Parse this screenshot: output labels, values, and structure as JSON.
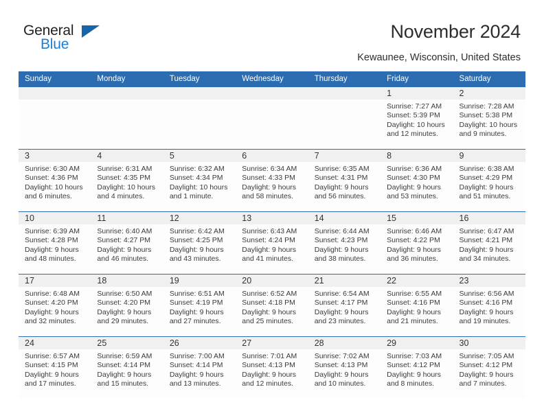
{
  "brand": {
    "name_top": "General",
    "name_bottom": "Blue",
    "accent_color": "#1b7fd4",
    "triangle_color": "#1565a8"
  },
  "header": {
    "title": "November 2024",
    "location": "Kewaunee, Wisconsin, United States",
    "header_bar_color": "#2c6cb0"
  },
  "calendar": {
    "day_names": [
      "Sunday",
      "Monday",
      "Tuesday",
      "Wednesday",
      "Thursday",
      "Friday",
      "Saturday"
    ],
    "weeks": [
      {
        "numbers": [
          "",
          "",
          "",
          "",
          "",
          "1",
          "2"
        ],
        "cells": [
          {
            "empty": true,
            "sunrise": "",
            "sunset": "",
            "daylight1": "",
            "daylight2": ""
          },
          {
            "empty": true,
            "sunrise": "",
            "sunset": "",
            "daylight1": "",
            "daylight2": ""
          },
          {
            "empty": true,
            "sunrise": "",
            "sunset": "",
            "daylight1": "",
            "daylight2": ""
          },
          {
            "empty": true,
            "sunrise": "",
            "sunset": "",
            "daylight1": "",
            "daylight2": ""
          },
          {
            "empty": true,
            "sunrise": "",
            "sunset": "",
            "daylight1": "",
            "daylight2": ""
          },
          {
            "empty": false,
            "sunrise": "Sunrise: 7:27 AM",
            "sunset": "Sunset: 5:39 PM",
            "daylight1": "Daylight: 10 hours",
            "daylight2": "and 12 minutes."
          },
          {
            "empty": false,
            "sunrise": "Sunrise: 7:28 AM",
            "sunset": "Sunset: 5:38 PM",
            "daylight1": "Daylight: 10 hours",
            "daylight2": "and 9 minutes."
          }
        ]
      },
      {
        "numbers": [
          "3",
          "4",
          "5",
          "6",
          "7",
          "8",
          "9"
        ],
        "cells": [
          {
            "empty": false,
            "sunrise": "Sunrise: 6:30 AM",
            "sunset": "Sunset: 4:36 PM",
            "daylight1": "Daylight: 10 hours",
            "daylight2": "and 6 minutes."
          },
          {
            "empty": false,
            "sunrise": "Sunrise: 6:31 AM",
            "sunset": "Sunset: 4:35 PM",
            "daylight1": "Daylight: 10 hours",
            "daylight2": "and 4 minutes."
          },
          {
            "empty": false,
            "sunrise": "Sunrise: 6:32 AM",
            "sunset": "Sunset: 4:34 PM",
            "daylight1": "Daylight: 10 hours",
            "daylight2": "and 1 minute."
          },
          {
            "empty": false,
            "sunrise": "Sunrise: 6:34 AM",
            "sunset": "Sunset: 4:33 PM",
            "daylight1": "Daylight: 9 hours",
            "daylight2": "and 58 minutes."
          },
          {
            "empty": false,
            "sunrise": "Sunrise: 6:35 AM",
            "sunset": "Sunset: 4:31 PM",
            "daylight1": "Daylight: 9 hours",
            "daylight2": "and 56 minutes."
          },
          {
            "empty": false,
            "sunrise": "Sunrise: 6:36 AM",
            "sunset": "Sunset: 4:30 PM",
            "daylight1": "Daylight: 9 hours",
            "daylight2": "and 53 minutes."
          },
          {
            "empty": false,
            "sunrise": "Sunrise: 6:38 AM",
            "sunset": "Sunset: 4:29 PM",
            "daylight1": "Daylight: 9 hours",
            "daylight2": "and 51 minutes."
          }
        ]
      },
      {
        "numbers": [
          "10",
          "11",
          "12",
          "13",
          "14",
          "15",
          "16"
        ],
        "cells": [
          {
            "empty": false,
            "sunrise": "Sunrise: 6:39 AM",
            "sunset": "Sunset: 4:28 PM",
            "daylight1": "Daylight: 9 hours",
            "daylight2": "and 48 minutes."
          },
          {
            "empty": false,
            "sunrise": "Sunrise: 6:40 AM",
            "sunset": "Sunset: 4:27 PM",
            "daylight1": "Daylight: 9 hours",
            "daylight2": "and 46 minutes."
          },
          {
            "empty": false,
            "sunrise": "Sunrise: 6:42 AM",
            "sunset": "Sunset: 4:25 PM",
            "daylight1": "Daylight: 9 hours",
            "daylight2": "and 43 minutes."
          },
          {
            "empty": false,
            "sunrise": "Sunrise: 6:43 AM",
            "sunset": "Sunset: 4:24 PM",
            "daylight1": "Daylight: 9 hours",
            "daylight2": "and 41 minutes."
          },
          {
            "empty": false,
            "sunrise": "Sunrise: 6:44 AM",
            "sunset": "Sunset: 4:23 PM",
            "daylight1": "Daylight: 9 hours",
            "daylight2": "and 38 minutes."
          },
          {
            "empty": false,
            "sunrise": "Sunrise: 6:46 AM",
            "sunset": "Sunset: 4:22 PM",
            "daylight1": "Daylight: 9 hours",
            "daylight2": "and 36 minutes."
          },
          {
            "empty": false,
            "sunrise": "Sunrise: 6:47 AM",
            "sunset": "Sunset: 4:21 PM",
            "daylight1": "Daylight: 9 hours",
            "daylight2": "and 34 minutes."
          }
        ]
      },
      {
        "numbers": [
          "17",
          "18",
          "19",
          "20",
          "21",
          "22",
          "23"
        ],
        "cells": [
          {
            "empty": false,
            "sunrise": "Sunrise: 6:48 AM",
            "sunset": "Sunset: 4:20 PM",
            "daylight1": "Daylight: 9 hours",
            "daylight2": "and 32 minutes."
          },
          {
            "empty": false,
            "sunrise": "Sunrise: 6:50 AM",
            "sunset": "Sunset: 4:20 PM",
            "daylight1": "Daylight: 9 hours",
            "daylight2": "and 29 minutes."
          },
          {
            "empty": false,
            "sunrise": "Sunrise: 6:51 AM",
            "sunset": "Sunset: 4:19 PM",
            "daylight1": "Daylight: 9 hours",
            "daylight2": "and 27 minutes."
          },
          {
            "empty": false,
            "sunrise": "Sunrise: 6:52 AM",
            "sunset": "Sunset: 4:18 PM",
            "daylight1": "Daylight: 9 hours",
            "daylight2": "and 25 minutes."
          },
          {
            "empty": false,
            "sunrise": "Sunrise: 6:54 AM",
            "sunset": "Sunset: 4:17 PM",
            "daylight1": "Daylight: 9 hours",
            "daylight2": "and 23 minutes."
          },
          {
            "empty": false,
            "sunrise": "Sunrise: 6:55 AM",
            "sunset": "Sunset: 4:16 PM",
            "daylight1": "Daylight: 9 hours",
            "daylight2": "and 21 minutes."
          },
          {
            "empty": false,
            "sunrise": "Sunrise: 6:56 AM",
            "sunset": "Sunset: 4:16 PM",
            "daylight1": "Daylight: 9 hours",
            "daylight2": "and 19 minutes."
          }
        ]
      },
      {
        "numbers": [
          "24",
          "25",
          "26",
          "27",
          "28",
          "29",
          "30"
        ],
        "cells": [
          {
            "empty": false,
            "sunrise": "Sunrise: 6:57 AM",
            "sunset": "Sunset: 4:15 PM",
            "daylight1": "Daylight: 9 hours",
            "daylight2": "and 17 minutes."
          },
          {
            "empty": false,
            "sunrise": "Sunrise: 6:59 AM",
            "sunset": "Sunset: 4:14 PM",
            "daylight1": "Daylight: 9 hours",
            "daylight2": "and 15 minutes."
          },
          {
            "empty": false,
            "sunrise": "Sunrise: 7:00 AM",
            "sunset": "Sunset: 4:14 PM",
            "daylight1": "Daylight: 9 hours",
            "daylight2": "and 13 minutes."
          },
          {
            "empty": false,
            "sunrise": "Sunrise: 7:01 AM",
            "sunset": "Sunset: 4:13 PM",
            "daylight1": "Daylight: 9 hours",
            "daylight2": "and 12 minutes."
          },
          {
            "empty": false,
            "sunrise": "Sunrise: 7:02 AM",
            "sunset": "Sunset: 4:13 PM",
            "daylight1": "Daylight: 9 hours",
            "daylight2": "and 10 minutes."
          },
          {
            "empty": false,
            "sunrise": "Sunrise: 7:03 AM",
            "sunset": "Sunset: 4:12 PM",
            "daylight1": "Daylight: 9 hours",
            "daylight2": "and 8 minutes."
          },
          {
            "empty": false,
            "sunrise": "Sunrise: 7:05 AM",
            "sunset": "Sunset: 4:12 PM",
            "daylight1": "Daylight: 9 hours",
            "daylight2": "and 7 minutes."
          }
        ]
      }
    ]
  }
}
